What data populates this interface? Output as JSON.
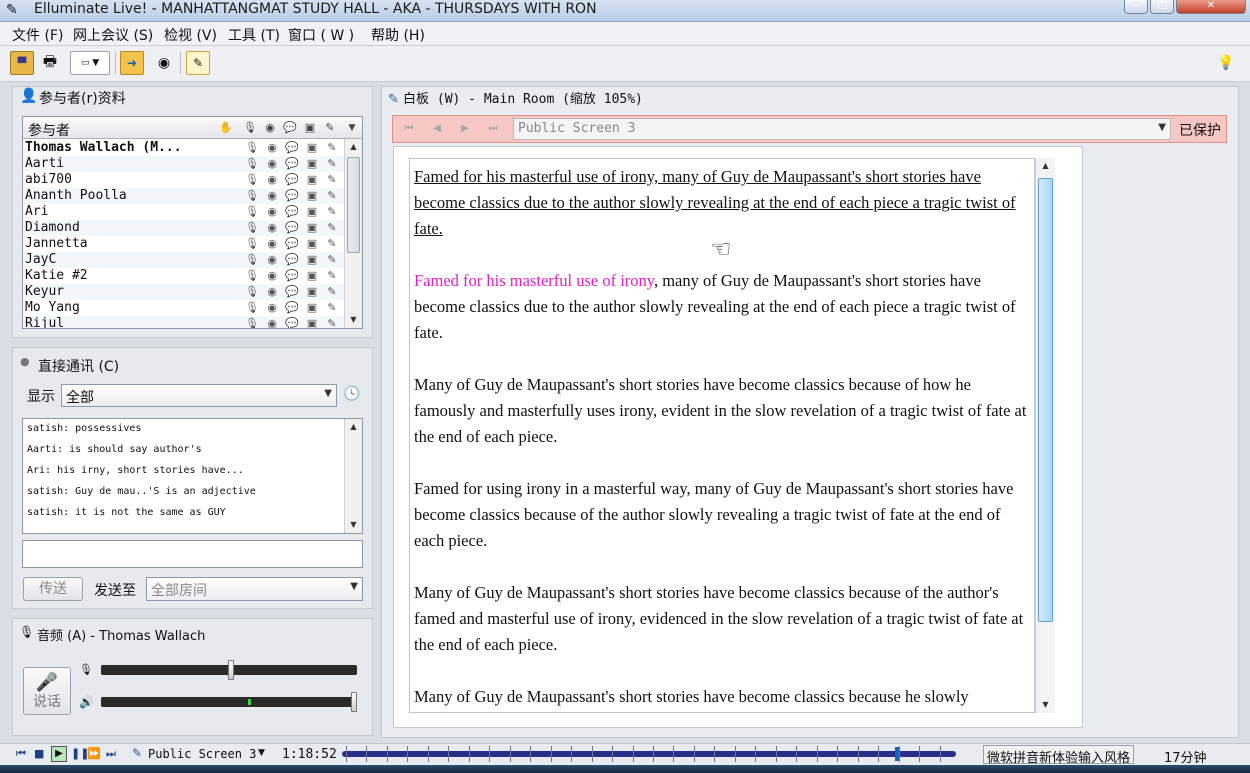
{
  "window": {
    "title": "Elluminate Live! - MANHATTANGMAT STUDY HALL - AKA - THURSDAYS WITH RON"
  },
  "menu": {
    "items": [
      "文件 (F)",
      "网上会议 (S)",
      "检视 (V)",
      "工具 (T)",
      "窗口 ( W )",
      "帮助 (H)"
    ]
  },
  "participants": {
    "panel_title": "参与者(r)资料",
    "column_header": "参与者",
    "names": [
      "Thomas Wallach (M...",
      "Aarti",
      "abi700",
      "Ananth Poolla",
      "Ari",
      "Diamond",
      "Jannetta",
      "JayC",
      "Katie #2",
      "Keyur",
      "Mo Yang",
      "Rijul"
    ]
  },
  "chat": {
    "panel_title": "直接通讯 (C)",
    "filter_label": "显示",
    "filter_value": "全部",
    "messages": [
      "satish: possessives",
      "Aarti: is should say author's",
      "Ari: his irny, short stories have...",
      "satish: Guy de mau..'S is an adjective",
      "satish: it is not the same as GUY"
    ],
    "input_value": "",
    "send_label": "传送",
    "send_to_label": "发送至",
    "send_to_value": "全部房间"
  },
  "audio": {
    "panel_title": "音频 (A) - Thomas Wallach",
    "talk_label": "说话",
    "mic_level": 0.5,
    "speaker_level": 1.0
  },
  "whiteboard": {
    "title": "白板 (W) - Main Room (缩放 105%)",
    "screen_select": "Public Screen 3",
    "protected_label": "已保护",
    "para1": "Famed for his masterful use of irony, many of Guy de Maupassant's short stories have become classics due to the author slowly revealing at the end of each piece a tragic twist of fate.",
    "para2_highlight": "Famed for his masterful use of irony",
    "para2_rest": ", many of Guy de Maupassant's short stories have become classics due to the author slowly revealing at the end of each piece a tragic twist of fate.",
    "para3": "Many of Guy de Maupassant's short stories have become classics because of how he famously and masterfully uses irony, evident in the slow revelation of a tragic twist of fate at the end of each piece.",
    "para4": "Famed for using irony in a masterful way, many of Guy de Maupassant's short stories have become classics because of the author slowly revealing a tragic twist of fate at the end of each piece.",
    "para5": "Many of Guy de Maupassant's short stories have become classics because of the author's famed and masterful use of irony, evidenced in the slow revelation of a tragic twist of fate at the end of each piece.",
    "para6": "Many of Guy de Maupassant's short stories have become classics because he slowly"
  },
  "playback": {
    "screen_label": "Public Screen 3",
    "time": "1:18:52",
    "progress": 0.9,
    "ime_label": "微软拼音新体验输入风格",
    "duration": "17分钟"
  },
  "colors": {
    "highlight": "#e020c8",
    "protected_bg": "#f7c7c4",
    "timeline": "#2b2f8a"
  }
}
